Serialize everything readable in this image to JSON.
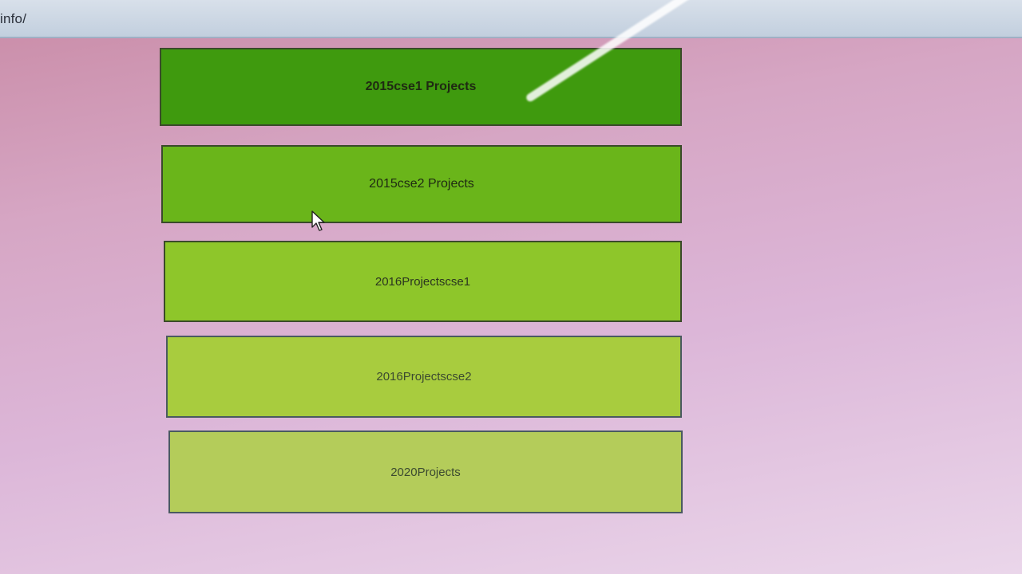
{
  "browser": {
    "address_text": "info/"
  },
  "projects": [
    {
      "label": "2015cse1 Projects",
      "color": "#3f9a0e"
    },
    {
      "label": "2015cse2 Projects",
      "color": "#6ab51a"
    },
    {
      "label": "2016Projectscse1",
      "color": "#8ec62a"
    },
    {
      "label": "2016Projectscse2",
      "color": "#a8cc3e"
    },
    {
      "label": "2020Projects",
      "color": "#b4cc5a"
    }
  ],
  "colors": {
    "background": "#d6a6c4",
    "address_bar": "#c9d4e1",
    "button_border": "#3a4a2a"
  },
  "icons": {
    "cursor": "mouse-pointer-icon"
  }
}
